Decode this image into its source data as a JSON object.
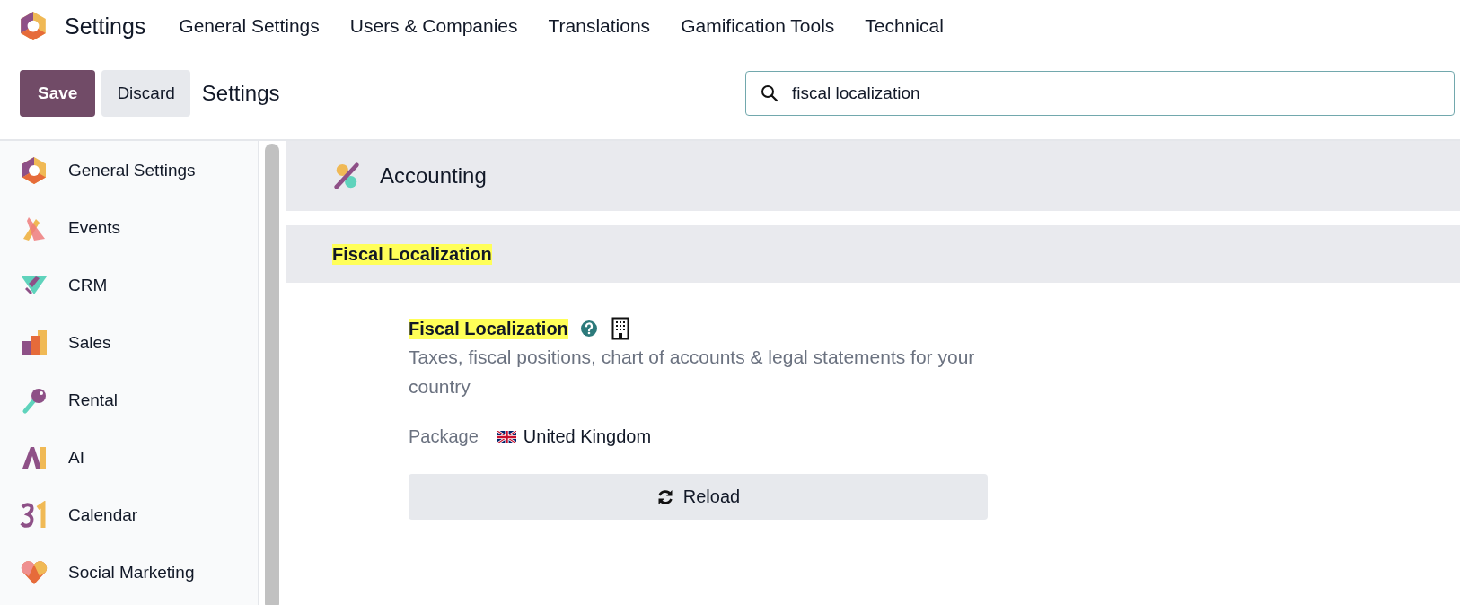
{
  "app_title": "Settings",
  "top_menu": [
    "General Settings",
    "Users & Companies",
    "Translations",
    "Gamification Tools",
    "Technical"
  ],
  "control_panel": {
    "buttons": [
      {
        "kind": "primary",
        "label": "Save"
      },
      {
        "kind": "secondary",
        "label": "Discard"
      }
    ],
    "breadcrumb": "Settings",
    "search": {
      "value": "fiscal localization"
    }
  },
  "sidebar": {
    "items": [
      {
        "kind": "general",
        "label": "General Settings"
      },
      {
        "kind": "events",
        "label": "Events"
      },
      {
        "kind": "crm",
        "label": "CRM"
      },
      {
        "kind": "sales",
        "label": "Sales"
      },
      {
        "kind": "rental",
        "label": "Rental"
      },
      {
        "kind": "ai",
        "label": "AI"
      },
      {
        "kind": "calendar",
        "label": "Calendar"
      },
      {
        "kind": "social",
        "label": "Social Marketing"
      }
    ]
  },
  "app_section": {
    "title": "Accounting",
    "block": {
      "title": "Fiscal Localization",
      "highlighted": true,
      "setting": {
        "title": "Fiscal Localization",
        "highlighted": true,
        "description": "Taxes, fiscal positions, chart of accounts & legal statements for your country",
        "field_label": "Package",
        "field_value": "United Kingdom",
        "button": "Reload"
      }
    }
  }
}
